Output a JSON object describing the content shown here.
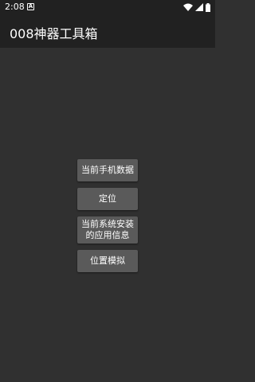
{
  "status_bar": {
    "time": "2:08",
    "notification_icon": "A",
    "icons": [
      "wifi-icon",
      "signal-icon",
      "battery-icon"
    ]
  },
  "app_bar": {
    "title": "008神器工具箱"
  },
  "buttons": [
    {
      "label": "当前手机数据"
    },
    {
      "label": "定位"
    },
    {
      "label": "当前系统安装的应用信息"
    },
    {
      "label": "位置模拟"
    }
  ],
  "colors": {
    "background": "#303030",
    "app_bar": "#212121",
    "button": "#5a5a5a",
    "text": "#ffffff"
  }
}
